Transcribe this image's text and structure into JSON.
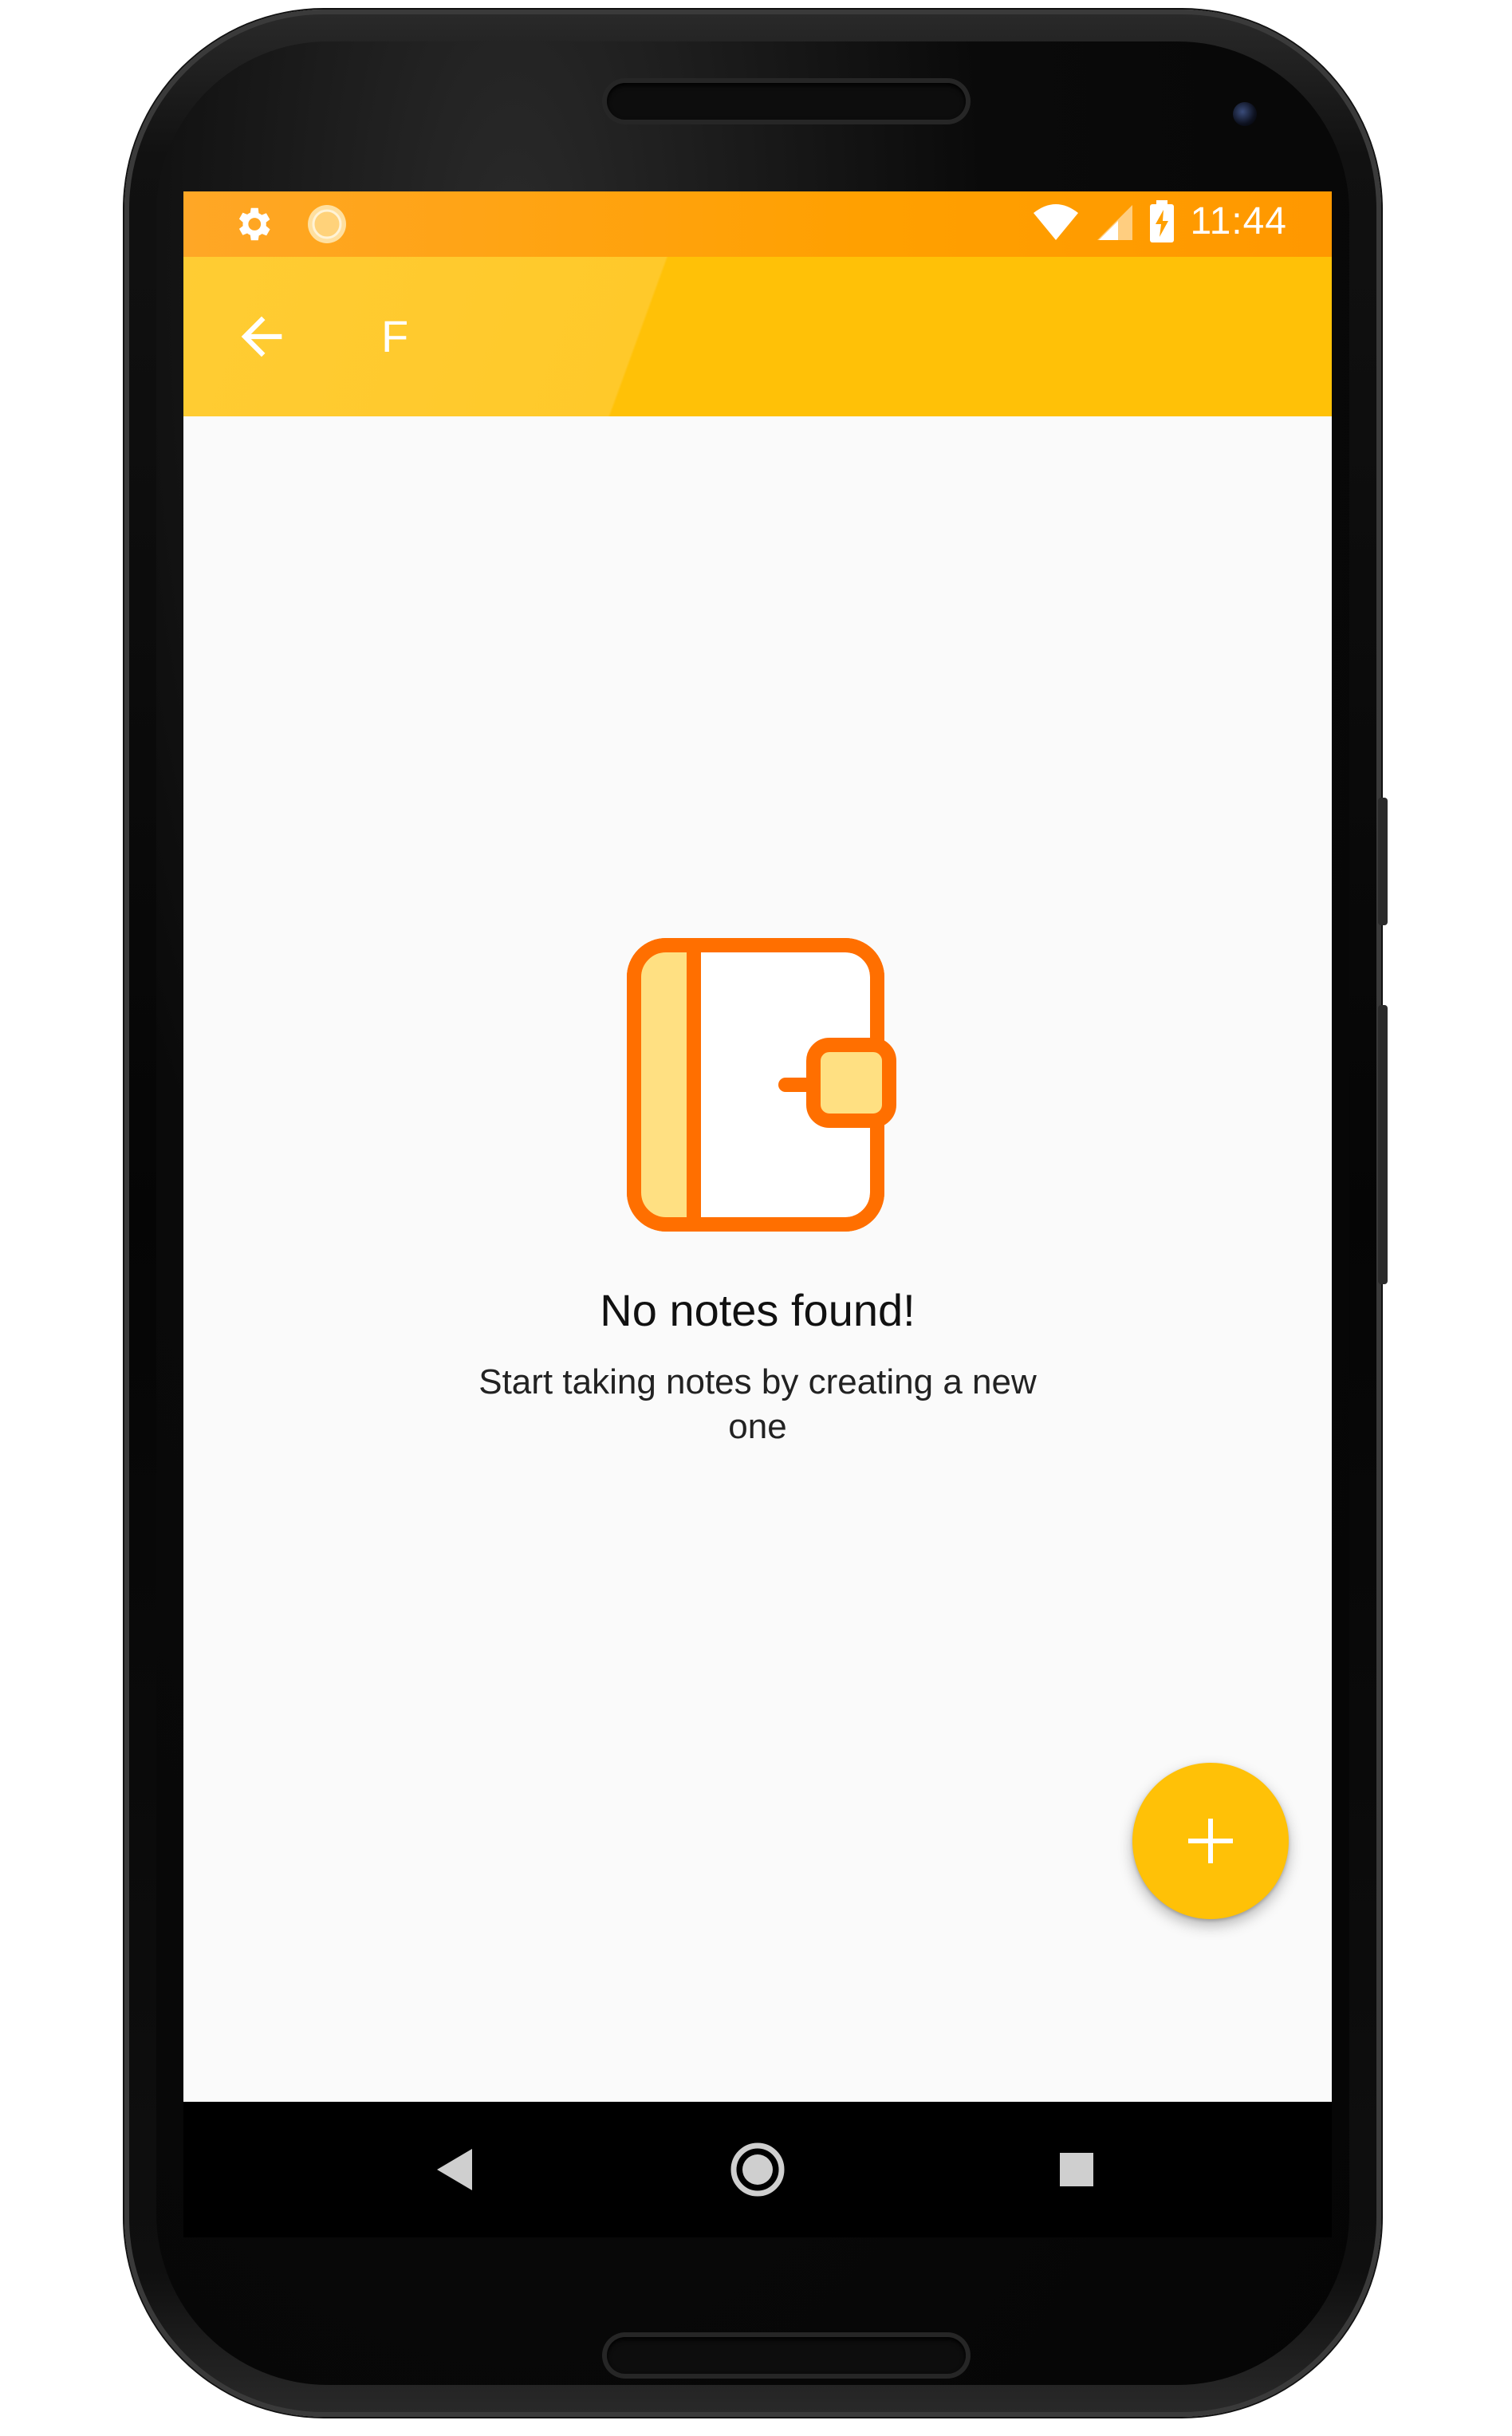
{
  "status_bar": {
    "time": "11:44",
    "left_icons": [
      "gear-icon",
      "notification-dot-icon"
    ],
    "right_icons": [
      "wifi-icon",
      "cellular-signal-icon",
      "battery-charging-icon"
    ],
    "color": "#ffa000"
  },
  "app_bar": {
    "title": "F",
    "back_icon": "arrow-back-icon",
    "color": "#ffc107"
  },
  "empty_state": {
    "icon": "notebook-icon",
    "title": "No notes found!",
    "subtitle": "Start taking notes by creating a new one",
    "icon_colors": {
      "stroke": "#ff6f00",
      "fill": "#ffe082"
    }
  },
  "fab": {
    "icon": "plus-icon",
    "color": "#ffc107"
  },
  "nav_bar": {
    "buttons": [
      "back-triangle-icon",
      "home-circle-icon",
      "recents-square-icon"
    ]
  }
}
